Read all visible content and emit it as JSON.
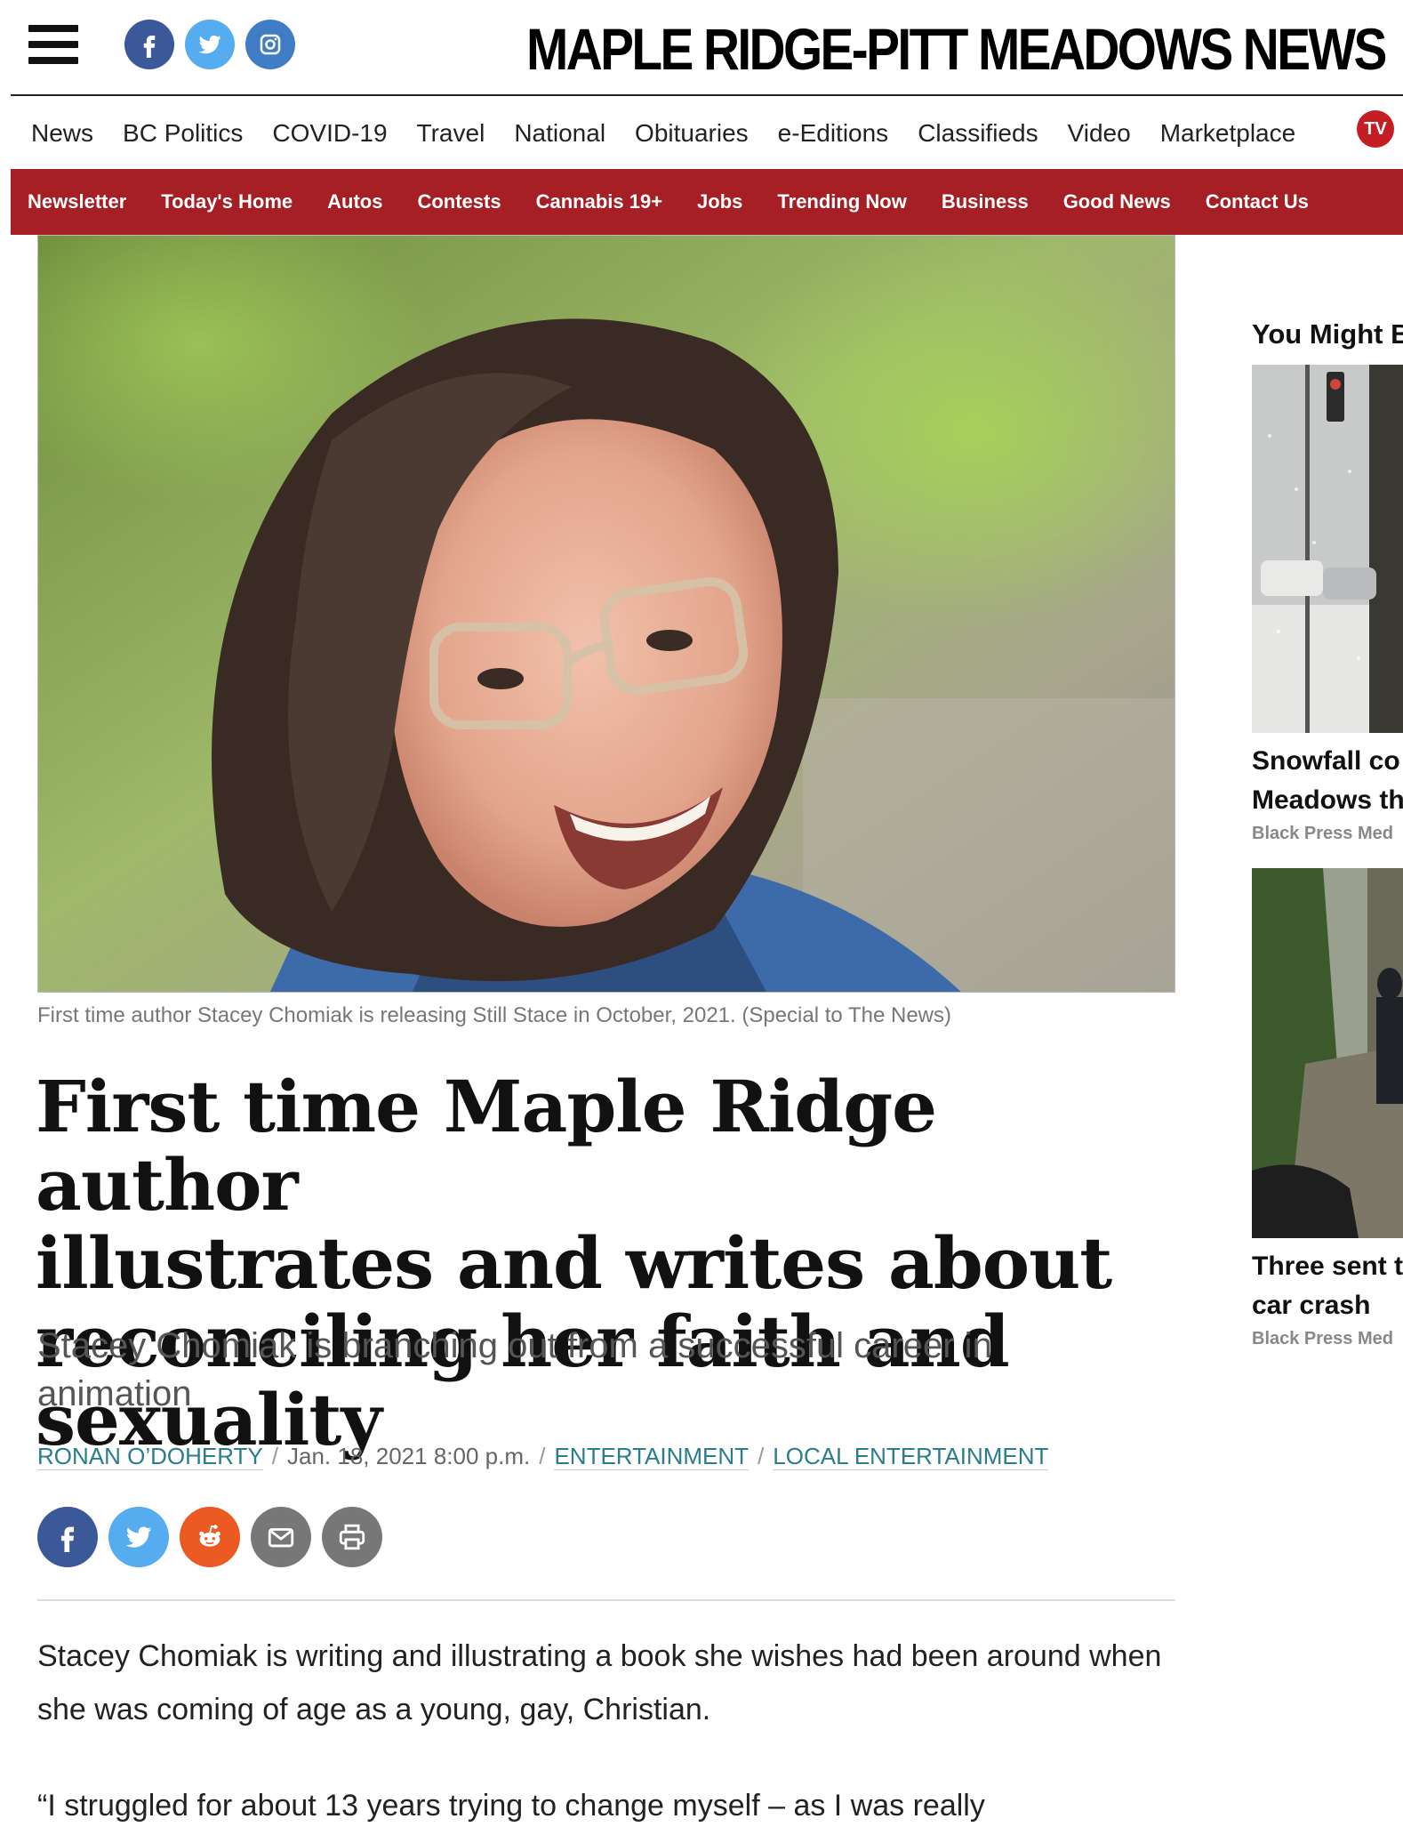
{
  "header": {
    "masthead": "MAPLE RIDGE-PITT MEADOWS NEWS",
    "social_icons": [
      "facebook-icon",
      "twitter-icon",
      "instagram-icon"
    ],
    "social_color_facebook": "#3b5998",
    "social_color_twitter": "#55acee"
  },
  "primary_nav": [
    "News",
    "BC Politics",
    "COVID-19",
    "Travel",
    "National",
    "Obituaries",
    "e-Editions",
    "Classifieds",
    "Video",
    "Marketplace"
  ],
  "tv_badge": "TV",
  "secondary_nav": [
    "Newsletter",
    "Today's Home",
    "Autos",
    "Contests",
    "Cannabis 19+",
    "Jobs",
    "Trending Now",
    "Business",
    "Good News",
    "Contact Us"
  ],
  "colors": {
    "brand_red": "#a51f24",
    "link_teal": "#2a7d8c"
  },
  "article": {
    "caption": "First time author Stacey Chomiak is releasing Still Stace in October, 2021. (Special to The News)",
    "headline_lines": [
      "First time Maple Ridge author",
      "illustrates and writes about",
      "reconciling her faith and sexuality"
    ],
    "dek": "Stacey Chomiak is branching out from a successful career in animation",
    "byline": {
      "author": "RONAN O’DOHERTY",
      "date": "Jan. 18, 2021 8:00 p.m.",
      "category": "ENTERTAINMENT",
      "subcategory": "LOCAL ENTERTAINMENT"
    },
    "share_buttons": [
      "facebook-icon",
      "twitter-icon",
      "reddit-icon",
      "email-icon",
      "print-icon"
    ],
    "paragraphs": [
      "Stacey Chomiak is writing and illustrating a book she wishes had been around when she was coming of age as a young, gay, Christian.",
      "“I struggled for about 13 years trying to change myself – as I was really"
    ]
  },
  "sidebar": {
    "title": "You Might B",
    "cards": [
      {
        "headline_lines": [
          "Snowfall co",
          "Meadows th"
        ],
        "source": "Black Press Med"
      },
      {
        "headline_lines": [
          "Three sent t",
          "car crash"
        ],
        "source": "Black Press Med"
      }
    ]
  }
}
